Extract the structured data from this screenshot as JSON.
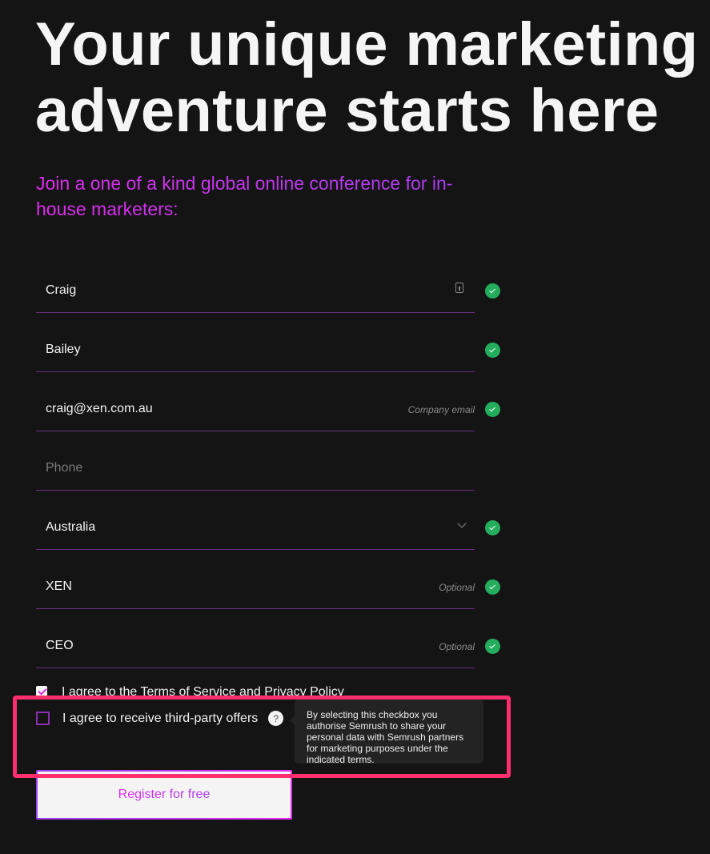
{
  "hero": {
    "title": "Your unique marketing adventure starts here",
    "subtitle": "Join a one of a kind global online conference for in-house marketers:"
  },
  "form": {
    "fields": [
      {
        "name": "first-name",
        "value": "Craig",
        "placeholder": "",
        "hint": "",
        "valid": true,
        "icon": "contact-card-icon"
      },
      {
        "name": "last-name",
        "value": "Bailey",
        "placeholder": "",
        "hint": "",
        "valid": true
      },
      {
        "name": "email",
        "value": "craig@xen.com.au",
        "placeholder": "",
        "hint": "Company email",
        "valid": true
      },
      {
        "name": "phone",
        "value": "",
        "placeholder": "Phone",
        "hint": "",
        "valid": false
      },
      {
        "name": "country",
        "value": "Australia",
        "placeholder": "",
        "hint": "",
        "valid": true,
        "icon": "chevron-down-icon"
      },
      {
        "name": "company",
        "value": "XEN",
        "placeholder": "",
        "hint": "Optional",
        "valid": true
      },
      {
        "name": "job-title",
        "value": "CEO",
        "placeholder": "",
        "hint": "Optional",
        "valid": true
      }
    ],
    "terms": {
      "checked": true,
      "prefix": "I agree to the ",
      "tos_link": "Terms of Service",
      "middle": " and ",
      "privacy_link": "Privacy Policy"
    },
    "offers": {
      "checked": false,
      "label": "I agree to receive third-party offers",
      "help_glyph": "?",
      "tooltip": "By selecting this checkbox you authorise Semrush to share your personal data with Semrush partners for marketing purposes under the indicated terms."
    },
    "submit_label": "Register for free"
  },
  "colors": {
    "background": "#141414",
    "accent_magenta": "#e22bf0",
    "accent_purple": "#a93ef0",
    "valid_green": "#23ad5c",
    "highlight": "#ff2e6e"
  }
}
